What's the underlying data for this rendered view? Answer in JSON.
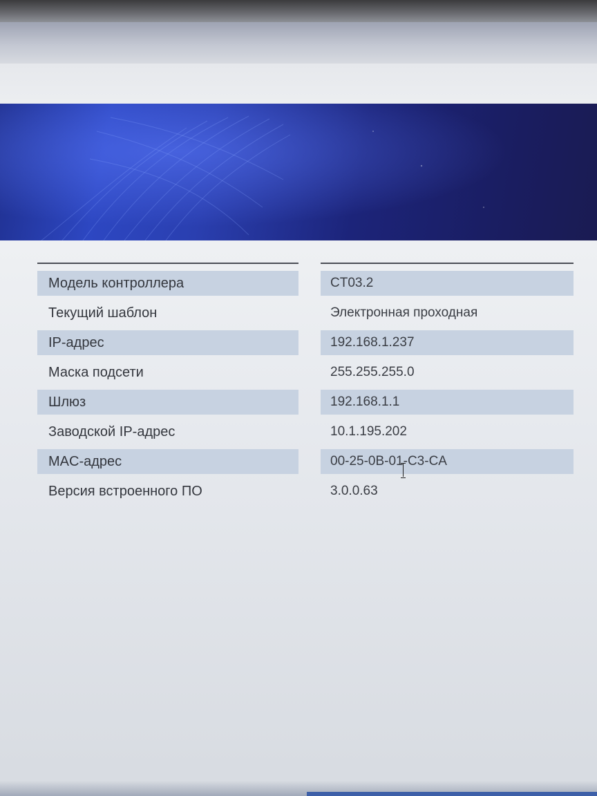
{
  "controller_info": {
    "rows": [
      {
        "label": "Модель контроллера",
        "value": "CT03.2"
      },
      {
        "label": "Текущий шаблон",
        "value": "Электронная проходная"
      },
      {
        "label": "IP-адрес",
        "value": "192.168.1.237"
      },
      {
        "label": "Маска подсети",
        "value": "255.255.255.0"
      },
      {
        "label": "Шлюз",
        "value": "192.168.1.1"
      },
      {
        "label": "Заводской IP-адрес",
        "value": "10.1.195.202"
      },
      {
        "label": "MAC-адрес",
        "value": "00-25-0B-01-C3-CA"
      },
      {
        "label": "Версия встроенного ПО",
        "value": "3.0.0.63"
      }
    ]
  },
  "colors": {
    "banner": "#1f2f8e",
    "row_shade": "#c7d2e1",
    "text": "#33363d"
  },
  "icons": [
    "text-cursor-icon"
  ]
}
